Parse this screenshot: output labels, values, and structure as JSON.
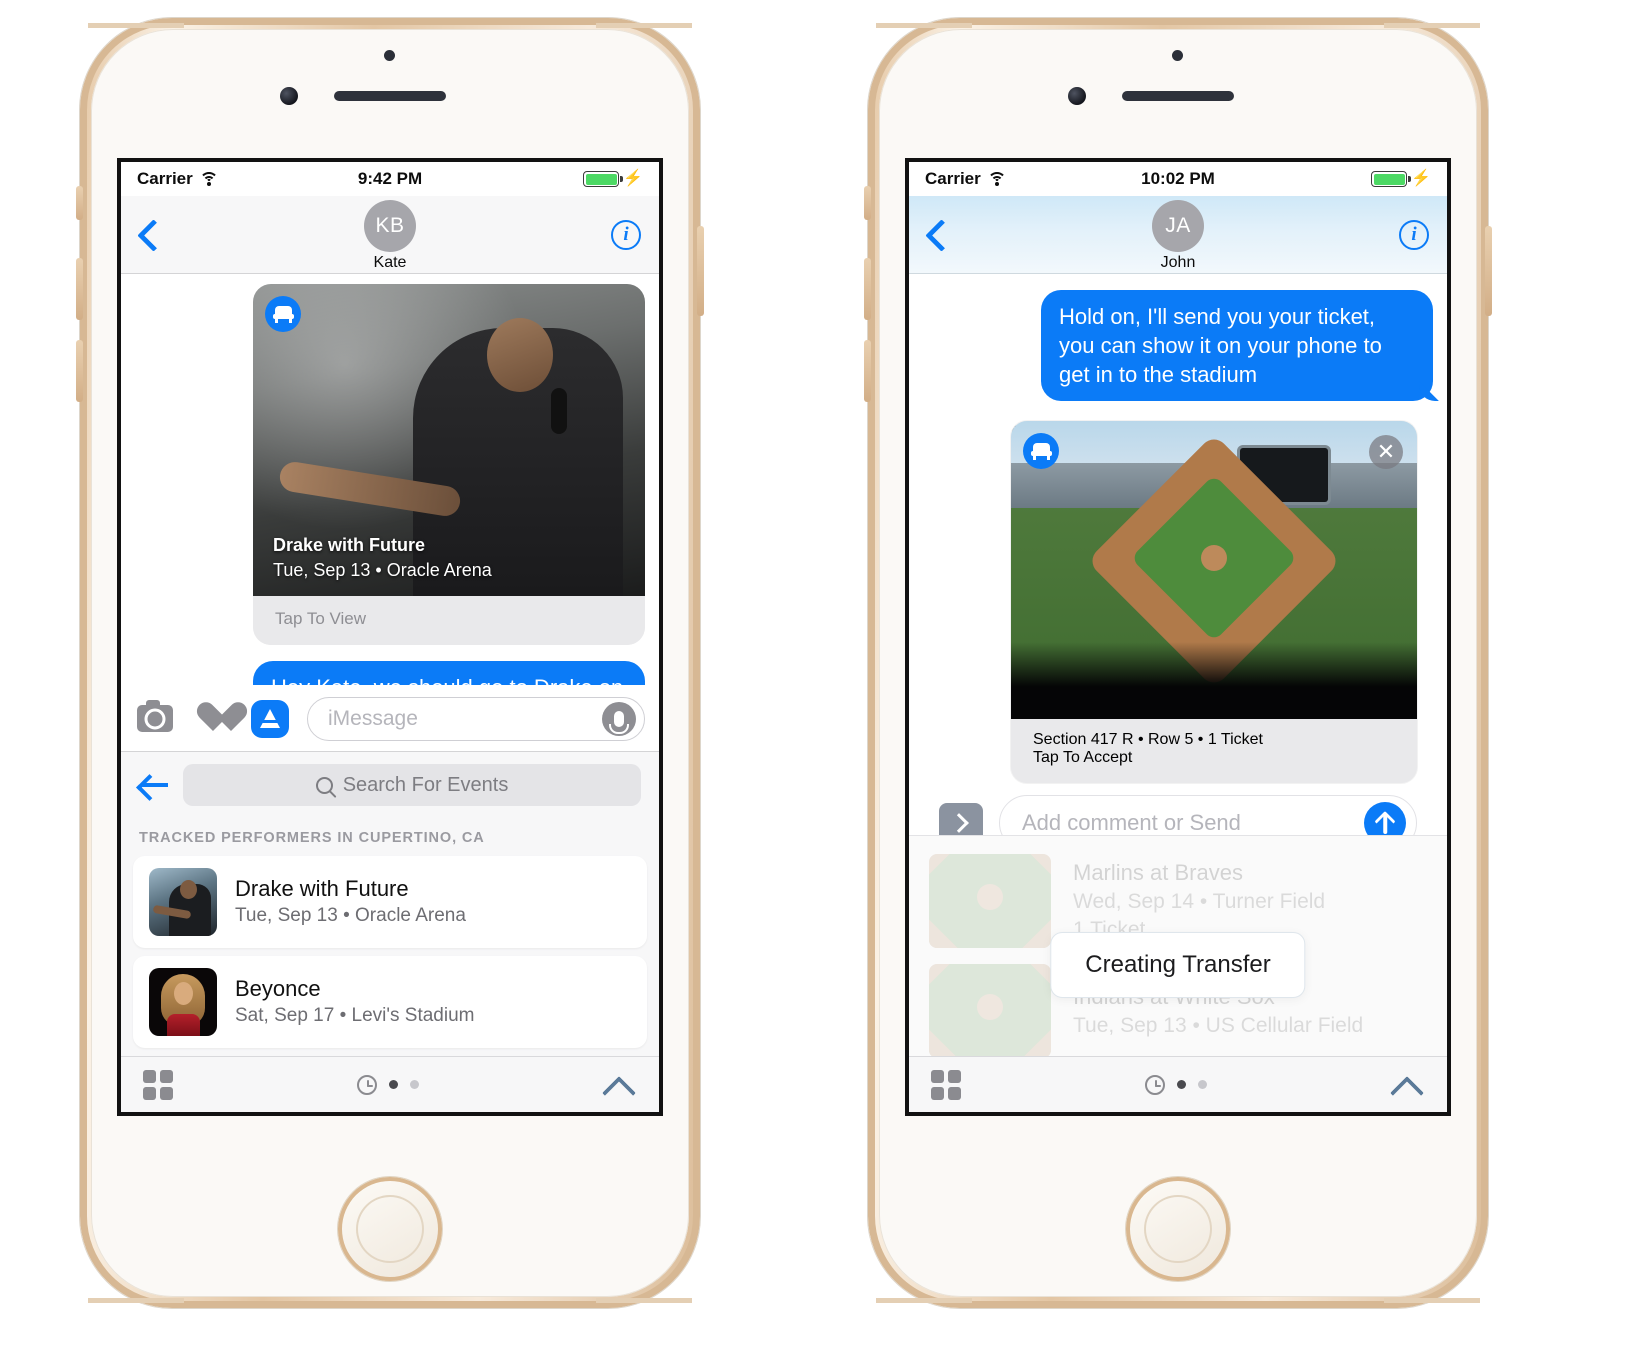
{
  "phones": [
    {
      "id": "left",
      "status": {
        "carrier": "Carrier",
        "time": "9:42 PM",
        "wifi_icon": "wifi-icon",
        "battery_icon": "battery-icon",
        "charging_icon": "bolt-icon"
      },
      "nav": {
        "back_icon": "chevron-left-icon",
        "avatar_initials": "KB",
        "contact_name": "Kate",
        "info_icon": "info-icon"
      },
      "event_card": {
        "app_icon": "seat-app-icon",
        "title": "Drake with Future",
        "subtitle": "Tue, Sep 13 • Oracle Arena",
        "action": "Tap To View"
      },
      "bubble": "Hey Kate, we should go to Drake on Tuesday!",
      "msgbar": {
        "camera_icon": "camera-icon",
        "digital_touch_icon": "digital-touch-heart-icon",
        "appstore_icon": "app-store-icon",
        "placeholder": "iMessage",
        "mic_icon": "microphone-icon"
      },
      "drawer": {
        "back_icon": "arrow-left-icon",
        "search_icon": "search-icon",
        "search_placeholder": "Search For Events",
        "section_title": "TRACKED PERFORMERS IN CUPERTINO, CA",
        "rows": [
          {
            "thumb": "drake-thumbnail",
            "name": "Drake with Future",
            "sub": "Tue, Sep 13 • Oracle Arena"
          },
          {
            "thumb": "beyonce-thumbnail",
            "name": "Beyonce",
            "sub": "Sat, Sep 17 • Levi's Stadium"
          }
        ]
      },
      "appbar": {
        "grid_icon": "app-grid-icon",
        "recents_icon": "recents-clock-icon",
        "page_dots": 2,
        "active_dot": 0,
        "expand_icon": "chevron-up-icon"
      }
    },
    {
      "id": "right",
      "status": {
        "carrier": "Carrier",
        "time": "10:02 PM",
        "wifi_icon": "wifi-icon",
        "battery_icon": "battery-icon",
        "charging_icon": "bolt-icon"
      },
      "nav": {
        "back_icon": "chevron-left-icon",
        "avatar_initials": "JA",
        "contact_name": "John",
        "info_icon": "info-icon"
      },
      "bubble": "Hold on, I'll send you your ticket, you can show it on your phone to get in to the stadium",
      "ticket_card": {
        "app_icon": "seat-app-icon",
        "close_icon": "close-icon",
        "title": "Marlins at Braves",
        "subtitle": "Wed, Sep 14 • Turner Field",
        "detail": "Section 417 R • Row 5 • 1 Ticket",
        "action": "Tap To Accept"
      },
      "comment_bar": {
        "expand_icon": "chevron-right-icon",
        "placeholder": "Add comment or Send",
        "send_icon": "send-arrow-up-icon"
      },
      "background_list": [
        {
          "thumb": "braves-stadium-thumbnail",
          "name": "Marlins at Braves",
          "sub": "Wed, Sep 14 • Turner Field",
          "extra": "1 Ticket"
        },
        {
          "thumb": "white-sox-stadium-thumbnail",
          "name": "Indians at White Sox",
          "sub": "Tue, Sep 13 • US Cellular Field",
          "extra": ""
        }
      ],
      "toast": "Creating Transfer",
      "appbar": {
        "grid_icon": "app-grid-icon",
        "recents_icon": "recents-clock-icon",
        "page_dots": 2,
        "active_dot": 0,
        "expand_icon": "chevron-up-icon"
      }
    }
  ],
  "colors": {
    "imessage_blue": "#0b7bf7",
    "card_gray": "#e9e9eb",
    "secondary_text": "#8e8e93",
    "battery_green": "#4cd964"
  }
}
